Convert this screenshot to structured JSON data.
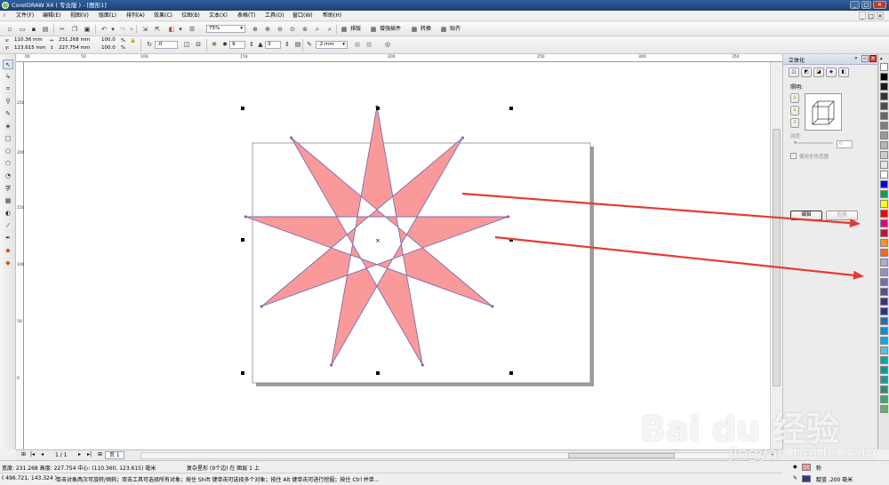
{
  "window": {
    "title": "CorelDRAW X4 ( 专业版 ) - [图形1]",
    "minimize": "_",
    "maximize": "□",
    "close": "✕"
  },
  "menu": {
    "items": [
      "文件(F)",
      "编辑(E)",
      "视图(V)",
      "版面(L)",
      "排列(A)",
      "效果(C)",
      "位图(B)",
      "文本(X)",
      "表格(T)",
      "工具(O)",
      "窗口(W)",
      "帮助(H)"
    ],
    "doc_controls": [
      "_",
      "□",
      "✕"
    ]
  },
  "toolbar": {
    "zoom_value": "75%",
    "buttons": {
      "paiban": "排版",
      "zengqiang": "增强插件",
      "zhuanhuan": "转换",
      "tieqi": "贴齐"
    }
  },
  "property_bar": {
    "x": "110.36 mm",
    "y": "123.615 mm",
    "width": "231.268 mm",
    "height": "227.754 mm",
    "scale_x": "100.0",
    "scale_y": "100.0",
    "percent": "%",
    "angle": ".0",
    "points": "9",
    "sharpness": "3",
    "outline_width": ".2 mm"
  },
  "rulers": {
    "top": [
      "00",
      "50",
      "100",
      "150",
      "200",
      "250",
      "300",
      "350"
    ],
    "left": [
      "250",
      "200",
      "150",
      "100",
      "50",
      "0"
    ]
  },
  "docker": {
    "title": "立体化",
    "section_label": "照明:",
    "intensity_label": "强度:",
    "intensity_value": "0",
    "checkbox_label": "使用全色范围",
    "edit_button": "编辑",
    "apply_button": "应用"
  },
  "colors": {
    "star_fill": "#f9999a",
    "star_outline": "#7b6cab",
    "arrow": "#e53935",
    "title_bar": "#1b3f73",
    "palette": [
      "#ffffff",
      "#000000",
      "#1a1a1a",
      "#333333",
      "#4d4d4d",
      "#666666",
      "#808080",
      "#999999",
      "#b3b3b3",
      "#cccccc",
      "#e6e6e6",
      "#ffffff",
      "#0000ff",
      "#00a651",
      "#ffff00",
      "#ff0000",
      "#e6007e",
      "#c8102e",
      "#f7941d",
      "#f26522",
      "#b5a6cf",
      "#9b8ec4",
      "#7b6cab",
      "#5e4c95",
      "#3b3486",
      "#2e3192",
      "#1b6fb5",
      "#0093d0",
      "#00aeef",
      "#4fc3d9",
      "#00a99d",
      "#009e8e",
      "#1f9b8a",
      "#2c8f6f",
      "#3fa66a",
      "#62b06d"
    ]
  },
  "page_tabs": {
    "page_count": "1 / 1",
    "page_label": "页 1"
  },
  "status": {
    "dimensions": "宽度: 231.268 高度: 227.754 中心: (110.360, 123.615) 毫米",
    "object_info": "复杂星形 (9个边) 在 图层 1 上",
    "cursor": "( 496.721, 143.324 )",
    "hint": "单击对象两次可旋转/倾斜；双击工具可选择所有对象；按住 Shift 键单击可选择多个对象；按住 Alt 键单击可进行挖掘；按住 Ctrl 并单...",
    "fill_name": "粉",
    "outline_name": "靛蓝 .200 毫米"
  },
  "watermark": {
    "main": "Bai du 经验",
    "sub": "jingyan.baidu.com"
  }
}
